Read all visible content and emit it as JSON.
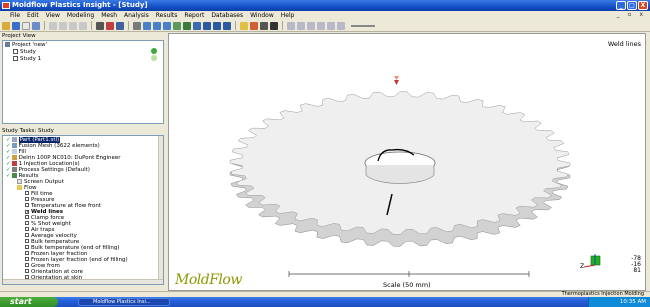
{
  "window": {
    "title": "Moldflow Plastics Insight - [Study]",
    "buttons": [
      "_",
      "□",
      "X"
    ]
  },
  "menu": {
    "items": [
      "File",
      "Edit",
      "View",
      "Modeling",
      "Mesh",
      "Analysis",
      "Results",
      "Report",
      "Databases",
      "Window",
      "Help"
    ],
    "mdi_controls": "_ ▫ x"
  },
  "project_view": {
    "title": "Project View",
    "root": "Project 'new'",
    "items": [
      "Study",
      "Study 1"
    ]
  },
  "study_tasks": {
    "title": "Study Tasks: Study",
    "items": [
      {
        "label": "Part (Part1.stl)",
        "selected": true
      },
      {
        "label": "Fusion Mesh (3622 elements)"
      },
      {
        "label": "Fill"
      },
      {
        "label": "Delrin 100P NC010: DuPont Engineer"
      },
      {
        "label": "1 Injection Location(s)"
      },
      {
        "label": "Process Settings (Default)"
      },
      {
        "label": "Results"
      },
      {
        "label": "Screen Output"
      },
      {
        "label": "Flow"
      },
      {
        "label": "Fill time"
      },
      {
        "label": "Pressure"
      },
      {
        "label": "Temperature at flow front"
      },
      {
        "label": "Weld lines",
        "checked": true
      },
      {
        "label": "Clamp force"
      },
      {
        "label": "% Shot weight"
      },
      {
        "label": "Air traps"
      },
      {
        "label": "Average velocity"
      },
      {
        "label": "Bulk temperature"
      },
      {
        "label": "Bulk temperature (end of filling)"
      },
      {
        "label": "Frozen layer fraction"
      },
      {
        "label": "Frozen layer fraction (end of filling)"
      },
      {
        "label": "Grow from"
      },
      {
        "label": "Orientation at core"
      },
      {
        "label": "Orientation at skin"
      }
    ]
  },
  "viewport": {
    "result_label": "Weld lines",
    "logo": "MoldFlow",
    "scale_label": "Scale (50 mm)",
    "axis_z_label": "Z",
    "orientation": [
      "-78",
      "-16",
      "81"
    ]
  },
  "statusbar": {
    "right_text": "Thermoplastics Injection Molding"
  },
  "taskbar": {
    "start_label": "start",
    "app_button": "Moldflow Plastics Insi...",
    "clock": "10:35 AM"
  },
  "colors": {
    "titlebar": "#1450c8",
    "logo": "#8a9a00",
    "gate_marker": "#c0392b",
    "weld_line": "#000000"
  }
}
